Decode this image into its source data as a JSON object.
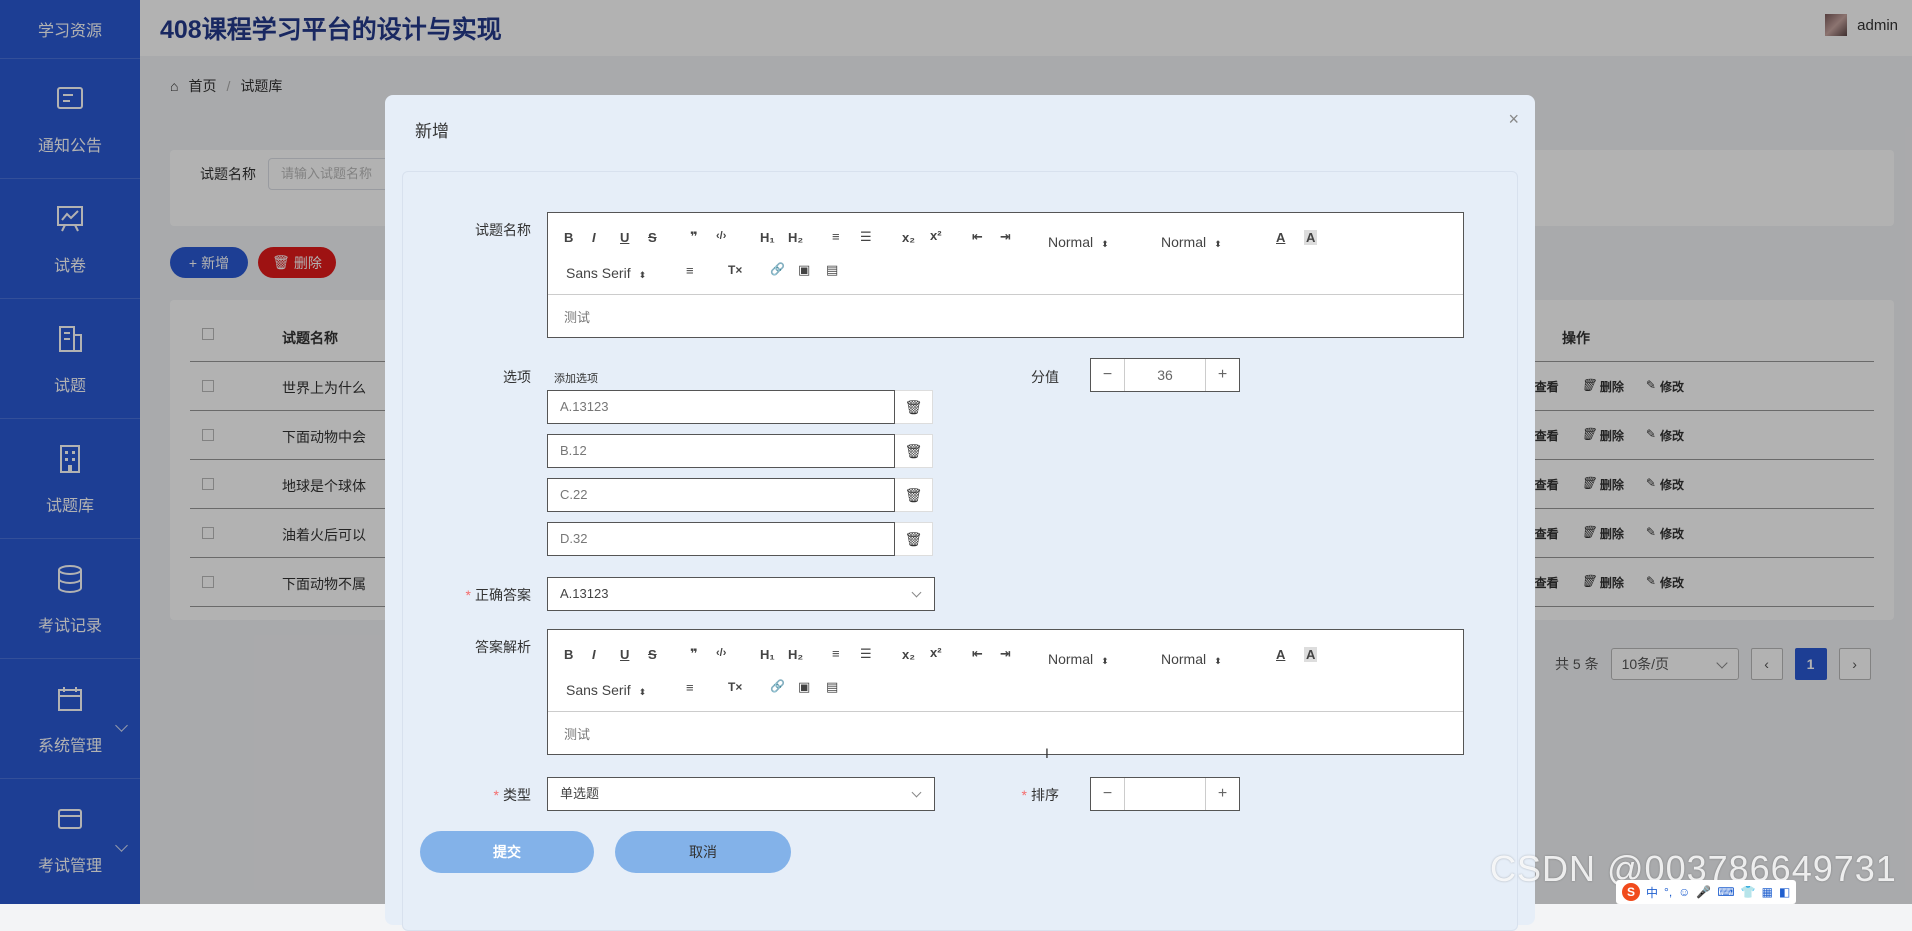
{
  "sidebar": {
    "top": "学习资源",
    "items": [
      {
        "label": "通知公告"
      },
      {
        "label": "试卷"
      },
      {
        "label": "试题"
      },
      {
        "label": "试题库"
      },
      {
        "label": "考试记录"
      },
      {
        "label": "系统管理"
      },
      {
        "label": "考试管理"
      }
    ]
  },
  "header": {
    "title": "408课程学习平台的设计与实现",
    "user": "admin"
  },
  "breadcrumb": {
    "home": "首页",
    "current": "试题库"
  },
  "search": {
    "label": "试题名称",
    "placeholder": "请输入试题名称"
  },
  "actions": {
    "add": "新增",
    "delete": "删除"
  },
  "table": {
    "col_name": "试题名称",
    "col_op": "操作",
    "rows": [
      {
        "name": "世界上为什么"
      },
      {
        "name": "下面动物中会"
      },
      {
        "name": "地球是个球体"
      },
      {
        "name": "油着火后可以"
      },
      {
        "name": "下面动物不属"
      }
    ],
    "ops": {
      "view": "查看",
      "delete": "删除",
      "edit": "修改"
    }
  },
  "pagination": {
    "total": "共 5 条",
    "page_size": "10条/页",
    "current": "1",
    "prev": "‹",
    "next": "›"
  },
  "dialog": {
    "title": "新增",
    "close": "×",
    "labels": {
      "question_name": "试题名称",
      "options": "选项",
      "score": "分值",
      "answer": "正确答案",
      "analysis": "答案解析",
      "type": "类型",
      "order": "排序"
    },
    "toolbar": {
      "bold": "B",
      "italic": "I",
      "underline": "U",
      "strike": "S",
      "quote": "❞",
      "code": "‹/›",
      "h1": "H₁",
      "h2": "H₂",
      "ol": "≡",
      "ul": "☰",
      "sub": "x₂",
      "sup": "x²",
      "outdent": "⇤",
      "indent": "⇥",
      "size": "Normal",
      "header": "Normal",
      "font": "Sans Serif",
      "color": "A",
      "bg": "A",
      "align": "≡",
      "clean": "T×",
      "link": "🔗",
      "image": "▣",
      "video": "▤"
    },
    "question_text": "测试",
    "add_option": "添加选项",
    "options": [
      "A.13123",
      "B.12",
      "C.22",
      "D.32"
    ],
    "score_value": "36",
    "answer_value": "A.13123",
    "analysis_text": "测试",
    "type_value": "单选题",
    "order_value": "",
    "submit": "提交",
    "cancel": "取消"
  },
  "watermark": "CSDN @003786649731",
  "ime": {
    "logo": "S",
    "lang": "中"
  }
}
